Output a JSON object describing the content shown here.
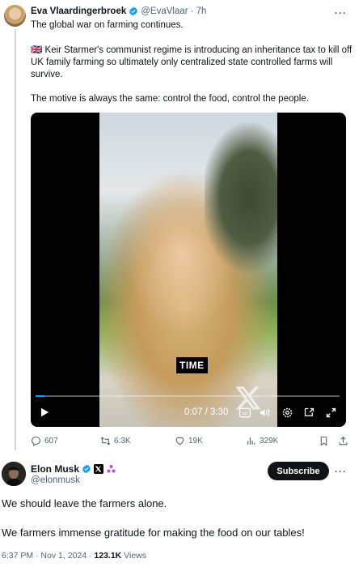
{
  "quoted": {
    "name": "Eva Vlaardingerbroek",
    "handle": "@EvaVlaar",
    "time": "· 7h",
    "line1": "The global war on farming continues.",
    "para1": "Keir Starmer's communist regime is introducing an inheritance tax to kill off UK family farming so ultimately only centralized state controlled farms will survive.",
    "para1_flag": "🇬🇧",
    "para2": "The motive is always the same: control the food, control the people.",
    "video": {
      "watermark": "TIME",
      "time": "0:07 / 3:30",
      "progress": 0.03
    },
    "actions": {
      "replies": "607",
      "reposts": "6.3K",
      "likes": "19K",
      "views": "329K"
    }
  },
  "main": {
    "name": "Elon Musk",
    "handle": "@elonmusk",
    "subscribe_label": "Subscribe",
    "text1": "We should leave the farmers alone.",
    "text2": "We farmers immense gratitude for making the food on our tables!",
    "timestamp": "6:37 PM · Nov 1, 2024 · ",
    "views_count": "123.1K",
    "views_label": " Views"
  },
  "colors": {
    "accent": "#1d9bf0",
    "text": "#0f1419",
    "muted": "#536471"
  }
}
